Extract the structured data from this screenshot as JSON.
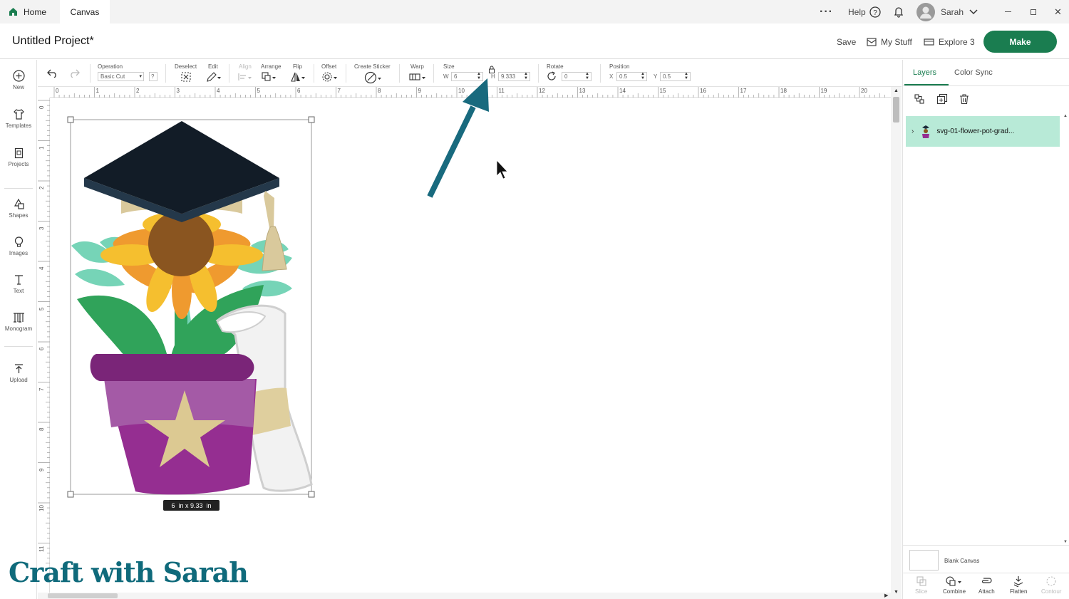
{
  "titlebar": {
    "tabs": [
      {
        "label": "Home"
      },
      {
        "label": "Canvas"
      }
    ],
    "help_label": "Help",
    "user_name": "Sarah"
  },
  "header": {
    "project_title": "Untitled Project*",
    "save_label": "Save",
    "my_stuff_label": "My Stuff",
    "machine_label": "Explore 3",
    "make_label": "Make"
  },
  "sidebar": {
    "items": [
      {
        "label": "New"
      },
      {
        "label": "Templates"
      },
      {
        "label": "Projects"
      },
      {
        "label": "Shapes"
      },
      {
        "label": "Images"
      },
      {
        "label": "Text"
      },
      {
        "label": "Monogram"
      },
      {
        "label": "Upload"
      }
    ]
  },
  "toolbar": {
    "operation_label": "Operation",
    "operation_value": "Basic Cut",
    "deselect_label": "Deselect",
    "edit_label": "Edit",
    "align_label": "Align",
    "arrange_label": "Arrange",
    "flip_label": "Flip",
    "offset_label": "Offset",
    "create_sticker_label": "Create Sticker",
    "warp_label": "Warp",
    "size_label": "Size",
    "width_letter": "W",
    "width_value": "6",
    "height_letter": "H",
    "height_value": "9.333",
    "rotate_label": "Rotate",
    "rotate_value": "0",
    "position_label": "Position",
    "x_letter": "X",
    "x_value": "0.5",
    "y_letter": "Y",
    "y_value": "0.5"
  },
  "canvas": {
    "ruler_top": [
      "0",
      "1",
      "2",
      "3",
      "4",
      "5",
      "6",
      "7",
      "8",
      "9",
      "10",
      "11",
      "12",
      "13",
      "14",
      "15",
      "16",
      "17",
      "18",
      "19",
      "20"
    ],
    "ruler_left": [
      "0",
      "1",
      "2",
      "3",
      "4",
      "5",
      "6",
      "7",
      "8",
      "9",
      "10",
      "11"
    ],
    "size_readout": "6  in x 9.33  in"
  },
  "panel": {
    "tab_layers": "Layers",
    "tab_color_sync": "Color Sync",
    "layer_name": "svg-01-flower-pot-grad...",
    "blank_canvas_label": "Blank Canvas",
    "bottom_actions": [
      {
        "label": "Slice"
      },
      {
        "label": "Combine"
      },
      {
        "label": "Attach"
      },
      {
        "label": "Flatten"
      },
      {
        "label": "Contour"
      }
    ]
  },
  "watermark": "Craft with Sarah",
  "colors": {
    "make_button": "#1a7d50",
    "layer_selected": "#b8ead7",
    "annotation_arrow": "#186a7e",
    "watermark": "#0f6a7b"
  }
}
